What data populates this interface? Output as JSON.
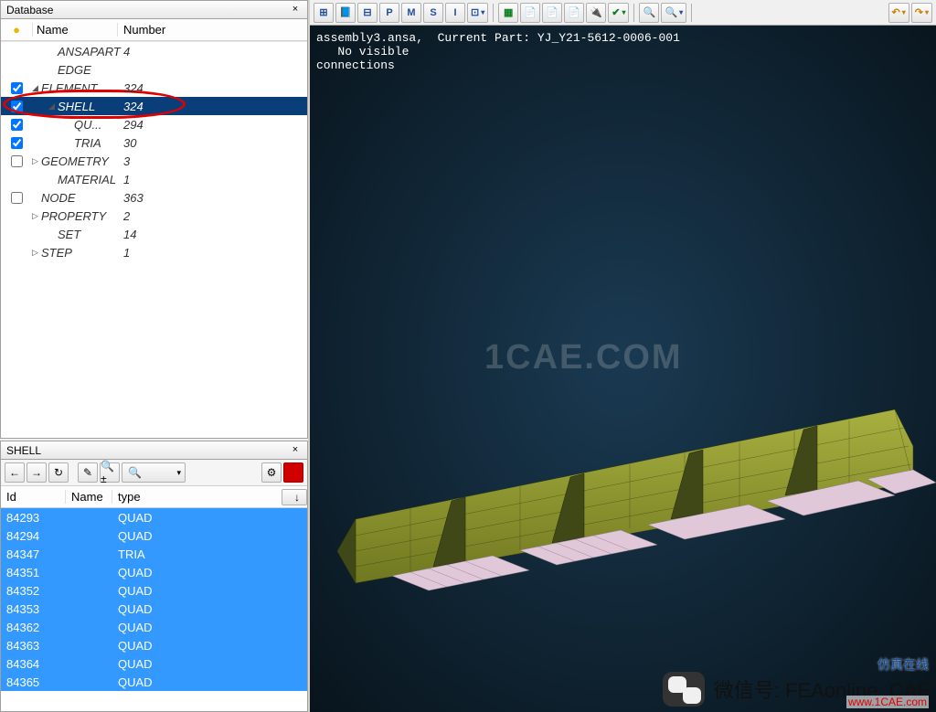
{
  "db_panel": {
    "title": "Database",
    "headers": {
      "bulb": "💡",
      "name": "Name",
      "number": "Number"
    },
    "rows": [
      {
        "checkbox": null,
        "indent": 1,
        "tri": "",
        "name": "ANSAPART",
        "num": "4",
        "italic": true
      },
      {
        "checkbox": null,
        "indent": 1,
        "tri": "",
        "name": "EDGE",
        "num": "",
        "italic": true
      },
      {
        "checkbox": true,
        "indent": 0,
        "tri": "◢",
        "name": "ELEMENT",
        "num": "324",
        "italic": true
      },
      {
        "checkbox": true,
        "indent": 1,
        "tri": "◢",
        "name": "SHELL",
        "num": "324",
        "italic": true,
        "selected": true
      },
      {
        "checkbox": true,
        "indent": 2,
        "tri": "",
        "name": "QU...",
        "num": "294",
        "italic": true
      },
      {
        "checkbox": true,
        "indent": 2,
        "tri": "",
        "name": "TRIA",
        "num": "30",
        "italic": true
      },
      {
        "checkbox": false,
        "indent": 0,
        "tri": "▷",
        "name": "GEOMETRY",
        "num": "3",
        "italic": true
      },
      {
        "checkbox": null,
        "indent": 1,
        "tri": "",
        "name": "MATERIAL",
        "num": "1",
        "italic": true
      },
      {
        "checkbox": false,
        "indent": 0,
        "tri": "",
        "name": "NODE",
        "num": "363",
        "italic": true
      },
      {
        "checkbox": null,
        "indent": 0,
        "tri": "▷",
        "name": "PROPERTY",
        "num": "2",
        "italic": true
      },
      {
        "checkbox": null,
        "indent": 1,
        "tri": "",
        "name": "SET",
        "num": "14",
        "italic": true
      },
      {
        "checkbox": null,
        "indent": 0,
        "tri": "▷",
        "name": "STEP",
        "num": "1",
        "italic": true
      }
    ]
  },
  "shell_panel": {
    "title": "SHELL",
    "toolbar": {
      "search_placeholder": ""
    },
    "headers": {
      "id": "Id",
      "name": "Name",
      "type": "type",
      "btn": "↓"
    },
    "rows": [
      {
        "id": "84293",
        "name": "",
        "type": "QUAD"
      },
      {
        "id": "84294",
        "name": "",
        "type": "QUAD"
      },
      {
        "id": "84347",
        "name": "",
        "type": "TRIA"
      },
      {
        "id": "84351",
        "name": "",
        "type": "QUAD"
      },
      {
        "id": "84352",
        "name": "",
        "type": "QUAD"
      },
      {
        "id": "84353",
        "name": "",
        "type": "QUAD"
      },
      {
        "id": "84362",
        "name": "",
        "type": "QUAD"
      },
      {
        "id": "84363",
        "name": "",
        "type": "QUAD"
      },
      {
        "id": "84364",
        "name": "",
        "type": "QUAD"
      },
      {
        "id": "84365",
        "name": "",
        "type": "QUAD"
      }
    ]
  },
  "top_toolbar": {
    "buttons": [
      "⊞",
      "📘",
      "⊟",
      "P",
      "M",
      "S",
      "I",
      "⊡",
      "▦",
      "📄",
      "📄",
      "📄",
      "🔌",
      "✔",
      "🔍",
      "🔍",
      "↶",
      "↷"
    ]
  },
  "console": "assembly3.ansa,  Current Part: YJ_Y21-5612-0006-001\n   No visible\nconnections",
  "watermark": "1CAE.COM",
  "overlay": {
    "wechat_label": "微信号: FEAonline_CAE",
    "sub": "仿真在线",
    "url": "www.1CAE.com"
  }
}
